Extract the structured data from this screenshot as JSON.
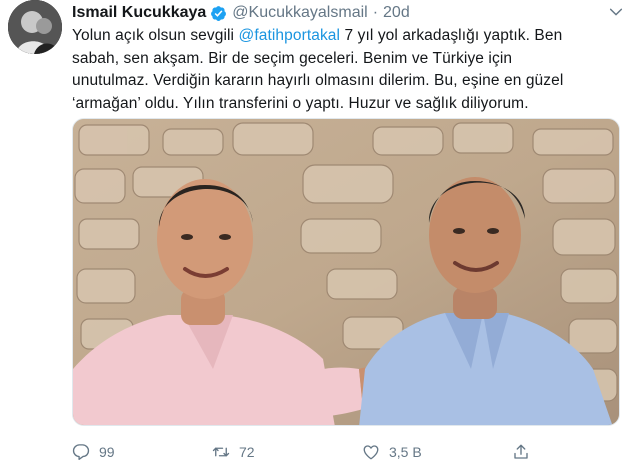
{
  "tweet": {
    "author": {
      "display_name": "Ismail Kucukkaya",
      "handle": "@Kucukkayalsmail",
      "verified": true
    },
    "separator": "·",
    "time": "20d",
    "text_lines": [
      {
        "before": "Yolun açık olsun sevgili ",
        "mention": "@fatihportakal",
        "after": " 7 yıl yol arkadaşlığı yaptık. Ben"
      },
      "sabah, sen akşam. Bir de seçim geceleri. Benim ve Türkiye için",
      "unutulmaz. Verdiğin kararın hayırlı olmasını dilerim. Bu, eşine en güzel",
      "‘armağan’ oldu. Yılın transferini o yaptı. Huzur ve sağlık diliyorum."
    ],
    "actions": {
      "reply_count": "99",
      "retweet_count": "72",
      "like_count": "3,5 B",
      "share_label": ""
    }
  },
  "colors": {
    "accent": "#1b95e0",
    "muted": "#657786",
    "text": "#14171a"
  },
  "icons": [
    "verified-badge-icon",
    "chevron-down-icon",
    "reply-icon",
    "retweet-icon",
    "like-icon",
    "share-icon"
  ]
}
